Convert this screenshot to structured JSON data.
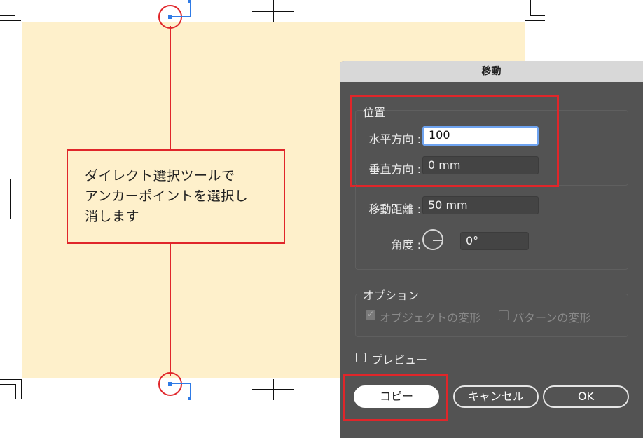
{
  "canvas": {
    "callout": {
      "lines": [
        "ダイレクト選択ツールで",
        "アンカーポイントを選択し",
        "消します"
      ]
    }
  },
  "dialog": {
    "title": "移動",
    "position": {
      "section_label": "位置",
      "horizontal_label": "水平方向 :",
      "horizontal_value": "100",
      "vertical_label": "垂直方向 :",
      "vertical_value": "0 mm"
    },
    "distance_label": "移動距離 :",
    "distance_value": "50 mm",
    "angle_label": "角度 :",
    "angle_value": "0°",
    "options": {
      "section_label": "オプション",
      "transform_objects_label": "オブジェクトの変形",
      "transform_objects_checked": true,
      "transform_patterns_label": "パターンの変形",
      "transform_patterns_checked": false
    },
    "preview_label": "プレビュー",
    "preview_checked": false,
    "buttons": {
      "copy": "コピー",
      "cancel": "キャンセル",
      "ok": "OK"
    }
  },
  "colors": {
    "artboard": "#fef0cb",
    "highlight": "#e0262a",
    "anchor": "#2f7be6",
    "dialog_bg": "#535353"
  }
}
